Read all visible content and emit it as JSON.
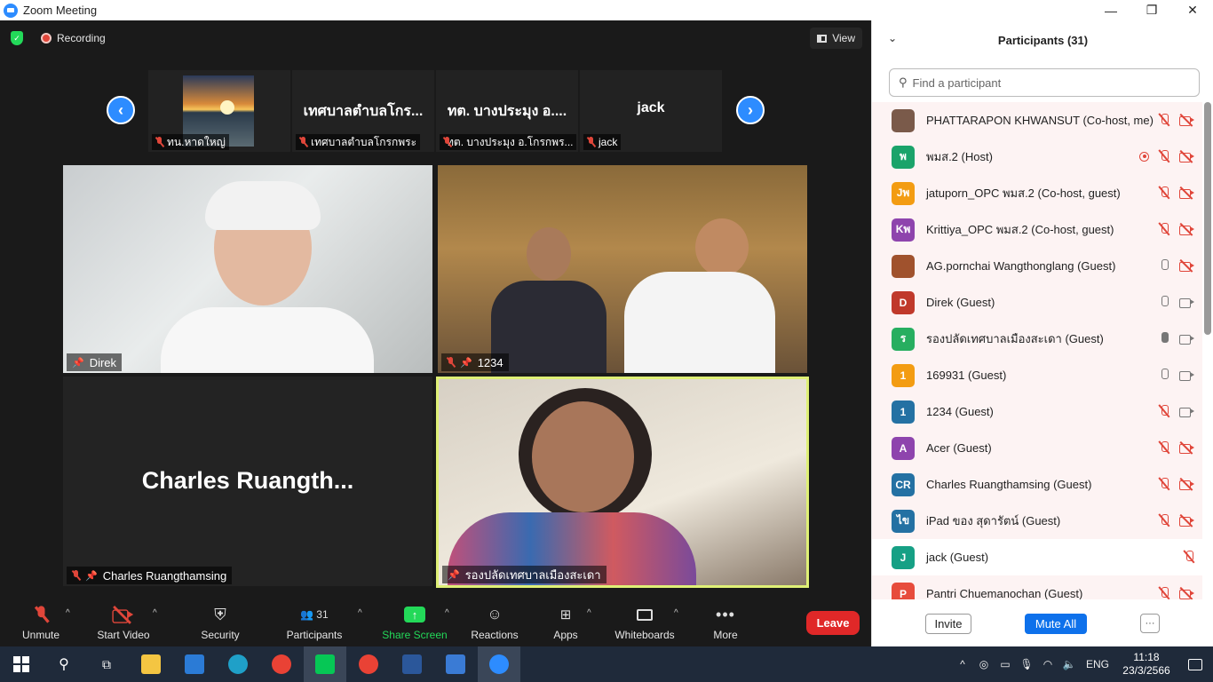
{
  "window": {
    "title": "Zoom Meeting",
    "minimize": "—",
    "restore": "❐",
    "close": "✕"
  },
  "topbar": {
    "recording_label": "Recording",
    "view_label": "View"
  },
  "thumbnails": [
    {
      "big": "",
      "label": "ทน.หาดใหญ่"
    },
    {
      "big": "เทศบาลตำบลโกร...",
      "label": "เทศบาลตำบลโกรกพระ"
    },
    {
      "big": "ทต. บางประมุง อ....",
      "label": "ทต. บางประมุง อ.โกรกพร..."
    },
    {
      "big": "jack",
      "label": "jack"
    }
  ],
  "tiles": {
    "direk": "Direk",
    "t1234": "1234",
    "charles_big": "Charles  Ruangth...",
    "charles": "Charles Ruangthamsing",
    "deputy": "รองปลัดเทศบาลเมืองสะเดา"
  },
  "toolbar": {
    "unmute": "Unmute",
    "start_video": "Start Video",
    "security": "Security",
    "participants": "Participants",
    "participants_count": "31",
    "share_screen": "Share Screen",
    "reactions": "Reactions",
    "apps": "Apps",
    "whiteboards": "Whiteboards",
    "more": "More",
    "leave": "Leave"
  },
  "panel": {
    "title": "Participants (31)",
    "search_placeholder": "Find a participant",
    "invite": "Invite",
    "mute_all": "Mute All",
    "more": "···",
    "participants": [
      {
        "initials": "",
        "color": "#7a5a4a",
        "name": "PHATTARAPON KHWANSUT (Co-host, me)",
        "mic": "off",
        "cam": "off",
        "rec": false,
        "hl": true
      },
      {
        "initials": "พ",
        "color": "#1aa36a",
        "name": "พมส.2 (Host)",
        "mic": "off",
        "cam": "off",
        "rec": true,
        "hl": true
      },
      {
        "initials": "Jพ",
        "color": "#f39c12",
        "name": "jatuporn_OPC พมส.2 (Co-host, guest)",
        "mic": "off",
        "cam": "off",
        "rec": false,
        "hl": true
      },
      {
        "initials": "Kพ",
        "color": "#8e44ad",
        "name": "Krittiya_OPC พมส.2 (Co-host, guest)",
        "mic": "off",
        "cam": "off",
        "rec": false,
        "hl": true
      },
      {
        "initials": "",
        "color": "#a0522d",
        "name": "AG.pornchai  Wangthonglang (Guest)",
        "mic": "idle",
        "cam": "off",
        "rec": false,
        "hl": true
      },
      {
        "initials": "D",
        "color": "#c0392b",
        "name": "Direk (Guest)",
        "mic": "idle",
        "cam": "on",
        "rec": false,
        "hl": true
      },
      {
        "initials": "ร",
        "color": "#27ae60",
        "name": "รองปลัดเทศบาลเมืองสะเดา (Guest)",
        "mic": "on",
        "cam": "on",
        "rec": false,
        "hl": true
      },
      {
        "initials": "1",
        "color": "#f39c12",
        "name": "169931 (Guest)",
        "mic": "idle",
        "cam": "on",
        "rec": false,
        "hl": true
      },
      {
        "initials": "1",
        "color": "#2471a3",
        "name": "1234 (Guest)",
        "mic": "off",
        "cam": "on",
        "rec": false,
        "hl": true
      },
      {
        "initials": "A",
        "color": "#8e44ad",
        "name": "Acer (Guest)",
        "mic": "off",
        "cam": "off",
        "rec": false,
        "hl": true
      },
      {
        "initials": "CR",
        "color": "#2471a3",
        "name": "Charles Ruangthamsing (Guest)",
        "mic": "off",
        "cam": "off",
        "rec": false,
        "hl": true
      },
      {
        "initials": "ไข",
        "color": "#2471a3",
        "name": "iPad ของ สุดารัตน์ (Guest)",
        "mic": "off",
        "cam": "off",
        "rec": false,
        "hl": true
      },
      {
        "initials": "J",
        "color": "#16a085",
        "name": "jack (Guest)",
        "mic": "none",
        "cam": "off",
        "rec": false,
        "hl": false
      },
      {
        "initials": "P",
        "color": "#e74c3c",
        "name": "Pantri Chuemanochan (Guest)",
        "mic": "off",
        "cam": "off",
        "rec": false,
        "hl": true
      }
    ]
  },
  "taskbar": {
    "apps": [
      {
        "name": "file-explorer-icon",
        "color": "#f4c542"
      },
      {
        "name": "mail-icon",
        "color": "#2b7bd6"
      },
      {
        "name": "edge-icon",
        "color": "#1fa0c8"
      },
      {
        "name": "chrome-icon",
        "color": "#e94235"
      },
      {
        "name": "line-icon",
        "color": "#06c755"
      },
      {
        "name": "chrome-icon-2",
        "color": "#e94235"
      },
      {
        "name": "word-icon",
        "color": "#2b579a"
      },
      {
        "name": "photos-icon",
        "color": "#3a7bd5"
      },
      {
        "name": "zoom-icon",
        "color": "#2d8cff"
      }
    ],
    "lang": "ENG",
    "time": "11:18",
    "date": "23/3/2566"
  }
}
